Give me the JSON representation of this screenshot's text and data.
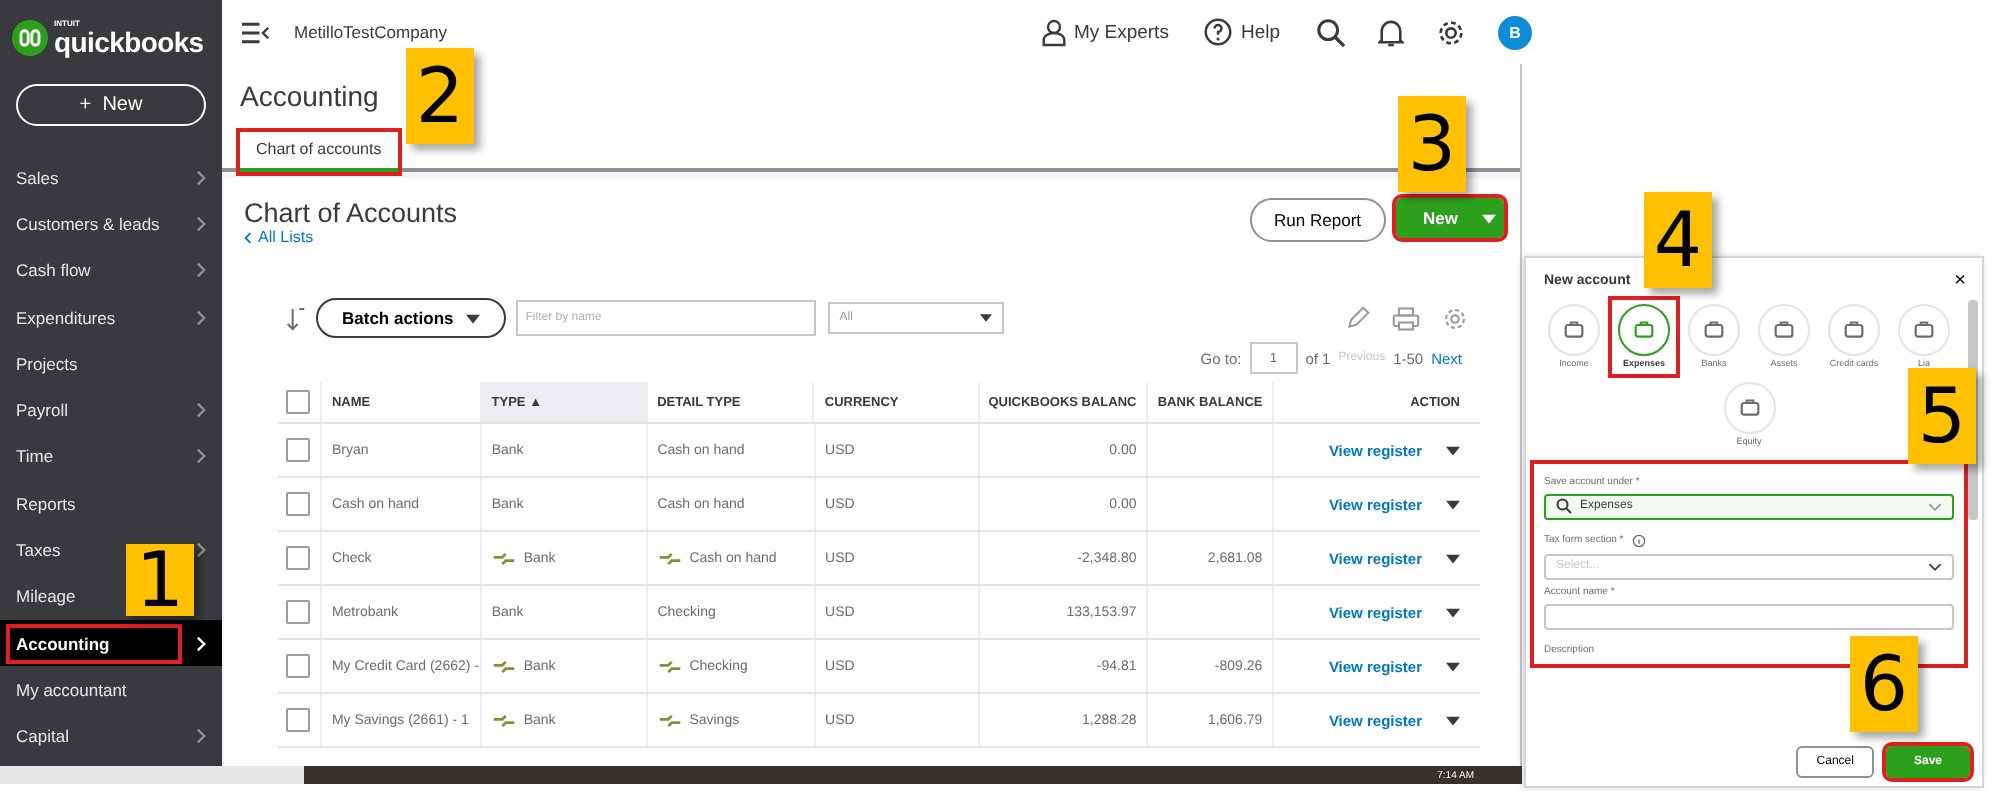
{
  "sidebar": {
    "logo_small": "INTUIT",
    "logo": "quickbooks",
    "new_button": "New",
    "new_icon": "+",
    "items": [
      {
        "label": "Sales",
        "submenu": true,
        "selected": false,
        "highlighted": false
      },
      {
        "label": "Customers & leads",
        "submenu": true,
        "selected": false,
        "highlighted": false
      },
      {
        "label": "Cash flow",
        "submenu": true,
        "selected": false,
        "highlighted": false
      },
      {
        "label": "Expenditures",
        "submenu": true,
        "selected": false,
        "highlighted": false
      },
      {
        "label": "Projects",
        "submenu": false,
        "selected": false,
        "highlighted": false
      },
      {
        "label": "Payroll",
        "submenu": true,
        "selected": false,
        "highlighted": false
      },
      {
        "label": "Time",
        "submenu": true,
        "selected": false,
        "highlighted": false
      },
      {
        "label": "Reports",
        "submenu": false,
        "selected": false,
        "highlighted": false
      },
      {
        "label": "Taxes",
        "submenu": true,
        "selected": false,
        "highlighted": false
      },
      {
        "label": "Mileage",
        "submenu": false,
        "selected": false,
        "highlighted": false
      },
      {
        "label": "Accounting",
        "submenu": true,
        "selected": true,
        "highlighted": true
      },
      {
        "label": "My accountant",
        "submenu": false,
        "selected": false,
        "highlighted": false
      },
      {
        "label": "Capital",
        "submenu": true,
        "selected": false,
        "highlighted": false
      }
    ]
  },
  "header": {
    "company": "MetilloTestCompany",
    "experts": "My Experts",
    "help": "Help",
    "avatar": "B"
  },
  "page": {
    "title": "Accounting",
    "tabs": [
      {
        "label": "Chart of accounts",
        "selected": true,
        "highlighted": true
      }
    ]
  },
  "chart": {
    "title": "Chart of Accounts",
    "back_link": "All Lists",
    "run_report": "Run Report",
    "new_button": {
      "label": "New",
      "highlighted": true
    },
    "all_checked": false,
    "batch_actions": "Batch actions",
    "filter": {
      "placeholder": "Filter by name"
    },
    "type_filter": "All",
    "pager": {
      "goto": "Go to:",
      "page": "1",
      "of": "of 1",
      "previous": "Previous",
      "range": "1-50",
      "next": "Next"
    },
    "columns": [
      "NAME",
      "TYPE ▲",
      "DETAIL TYPE",
      "CURRENCY",
      "QUICKBOOKS BALANC",
      "BANK BALANCE",
      "ACTION"
    ],
    "rows": [
      {
        "checked": false,
        "name": "Bryan",
        "type": "Bank",
        "detail_type": "Cash on hand",
        "currency": "USD",
        "qb_balance": "0.00",
        "bank_balance": "",
        "action": "View register",
        "linked": false
      },
      {
        "checked": false,
        "name": "Cash on hand",
        "type": "Bank",
        "detail_type": "Cash on hand",
        "currency": "USD",
        "qb_balance": "0.00",
        "bank_balance": "",
        "action": "View register",
        "linked": false
      },
      {
        "checked": false,
        "name": "Check",
        "type": "Bank",
        "detail_type": "Cash on hand",
        "currency": "USD",
        "qb_balance": "-2,348.80",
        "bank_balance": "2,681.08",
        "action": "View register",
        "linked": true
      },
      {
        "checked": false,
        "name": "Metrobank",
        "type": "Bank",
        "detail_type": "Checking",
        "currency": "USD",
        "qb_balance": "133,153.97",
        "bank_balance": "",
        "action": "View register",
        "linked": false
      },
      {
        "checked": false,
        "name": "My Credit Card (2662) -",
        "type": "Bank",
        "detail_type": "Checking",
        "currency": "USD",
        "qb_balance": "-94.81",
        "bank_balance": "-809.26",
        "action": "View register",
        "linked": true
      },
      {
        "checked": false,
        "name": "My Savings (2661) - 1",
        "type": "Bank",
        "detail_type": "Savings",
        "currency": "USD",
        "qb_balance": "1,288.28",
        "bank_balance": "1,606.79",
        "action": "View register",
        "linked": true
      }
    ]
  },
  "new_account": {
    "title": "New account",
    "close": "×",
    "types": [
      {
        "label": "Income",
        "selected": false,
        "highlighted": false
      },
      {
        "label": "Expenses",
        "selected": true,
        "highlighted": true
      },
      {
        "label": "Banks",
        "selected": false,
        "highlighted": false
      },
      {
        "label": "Assets",
        "selected": false,
        "highlighted": false
      },
      {
        "label": "Credit cards",
        "selected": false,
        "highlighted": false
      },
      {
        "label": "Lia",
        "selected": false,
        "highlighted": false
      },
      {
        "label": "Equity",
        "selected": false,
        "highlighted": false
      }
    ],
    "form_highlighted": true,
    "save_under_label": "Save account under *",
    "save_under_value": "Expenses",
    "tax_label": "Tax form section *",
    "tax_placeholder": "Select...",
    "name_label": "Account name *",
    "description_label": "Description",
    "cancel": "Cancel",
    "save": {
      "label": "Save",
      "highlighted": true
    }
  },
  "taskbar": {
    "time": "7:14 AM"
  },
  "callouts": [
    "1",
    "2",
    "3",
    "4",
    "5",
    "6"
  ]
}
